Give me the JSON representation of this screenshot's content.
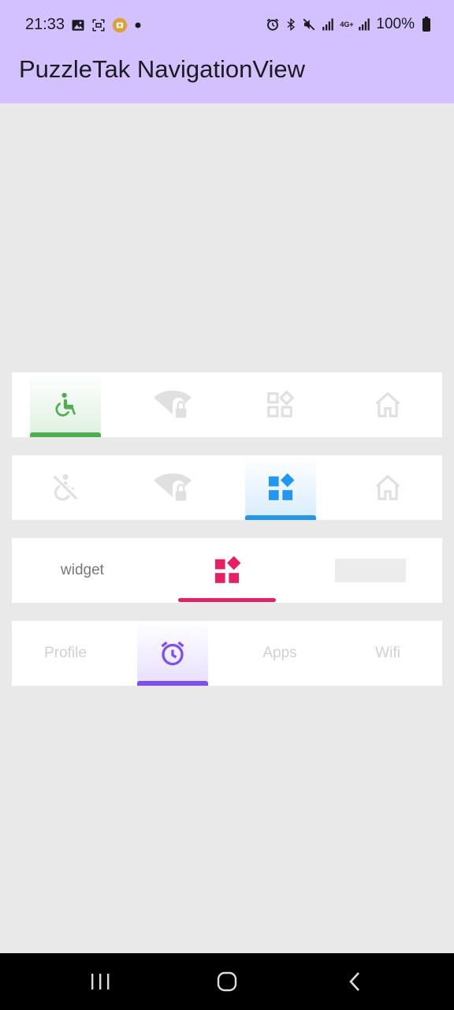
{
  "status_bar": {
    "time": "21:33",
    "battery_text": "100%",
    "left_icons": [
      "image-icon",
      "screenshot-icon",
      "app-notification-icon",
      "dot-icon"
    ],
    "right_icons": [
      "alarm-icon",
      "bluetooth-icon",
      "mute-icon",
      "signal-icon",
      "4g-signal-icon",
      "signal-icon",
      "battery-icon"
    ],
    "network_label": "4G+"
  },
  "app_bar": {
    "title": "PuzzleTak NavigationView"
  },
  "nav_views": [
    {
      "accent": "#4caf50",
      "selected_index": 0,
      "tabs": [
        {
          "icon": "accessible-icon"
        },
        {
          "icon": "wifi-lock-icon"
        },
        {
          "icon": "widgets-icon"
        },
        {
          "icon": "home-icon"
        }
      ]
    },
    {
      "accent": "#2196f3",
      "selected_index": 2,
      "tabs": [
        {
          "icon": "not-accessible-icon"
        },
        {
          "icon": "wifi-lock-icon"
        },
        {
          "icon": "widgets-icon"
        },
        {
          "icon": "home-icon"
        }
      ]
    },
    {
      "accent": "#e91e63",
      "selected_index": 1,
      "tabs": [
        {
          "label": "widget"
        },
        {
          "icon": "widgets-icon"
        },
        {
          "icon": "placeholder-box"
        }
      ]
    },
    {
      "accent": "#7c4dff",
      "selected_index": 1,
      "tabs": [
        {
          "label": "Profile"
        },
        {
          "icon": "alarm-icon"
        },
        {
          "label": "Apps"
        },
        {
          "label": "Wifi"
        }
      ]
    }
  ],
  "system_nav": [
    "recents-icon",
    "home-circle-icon",
    "back-icon"
  ]
}
